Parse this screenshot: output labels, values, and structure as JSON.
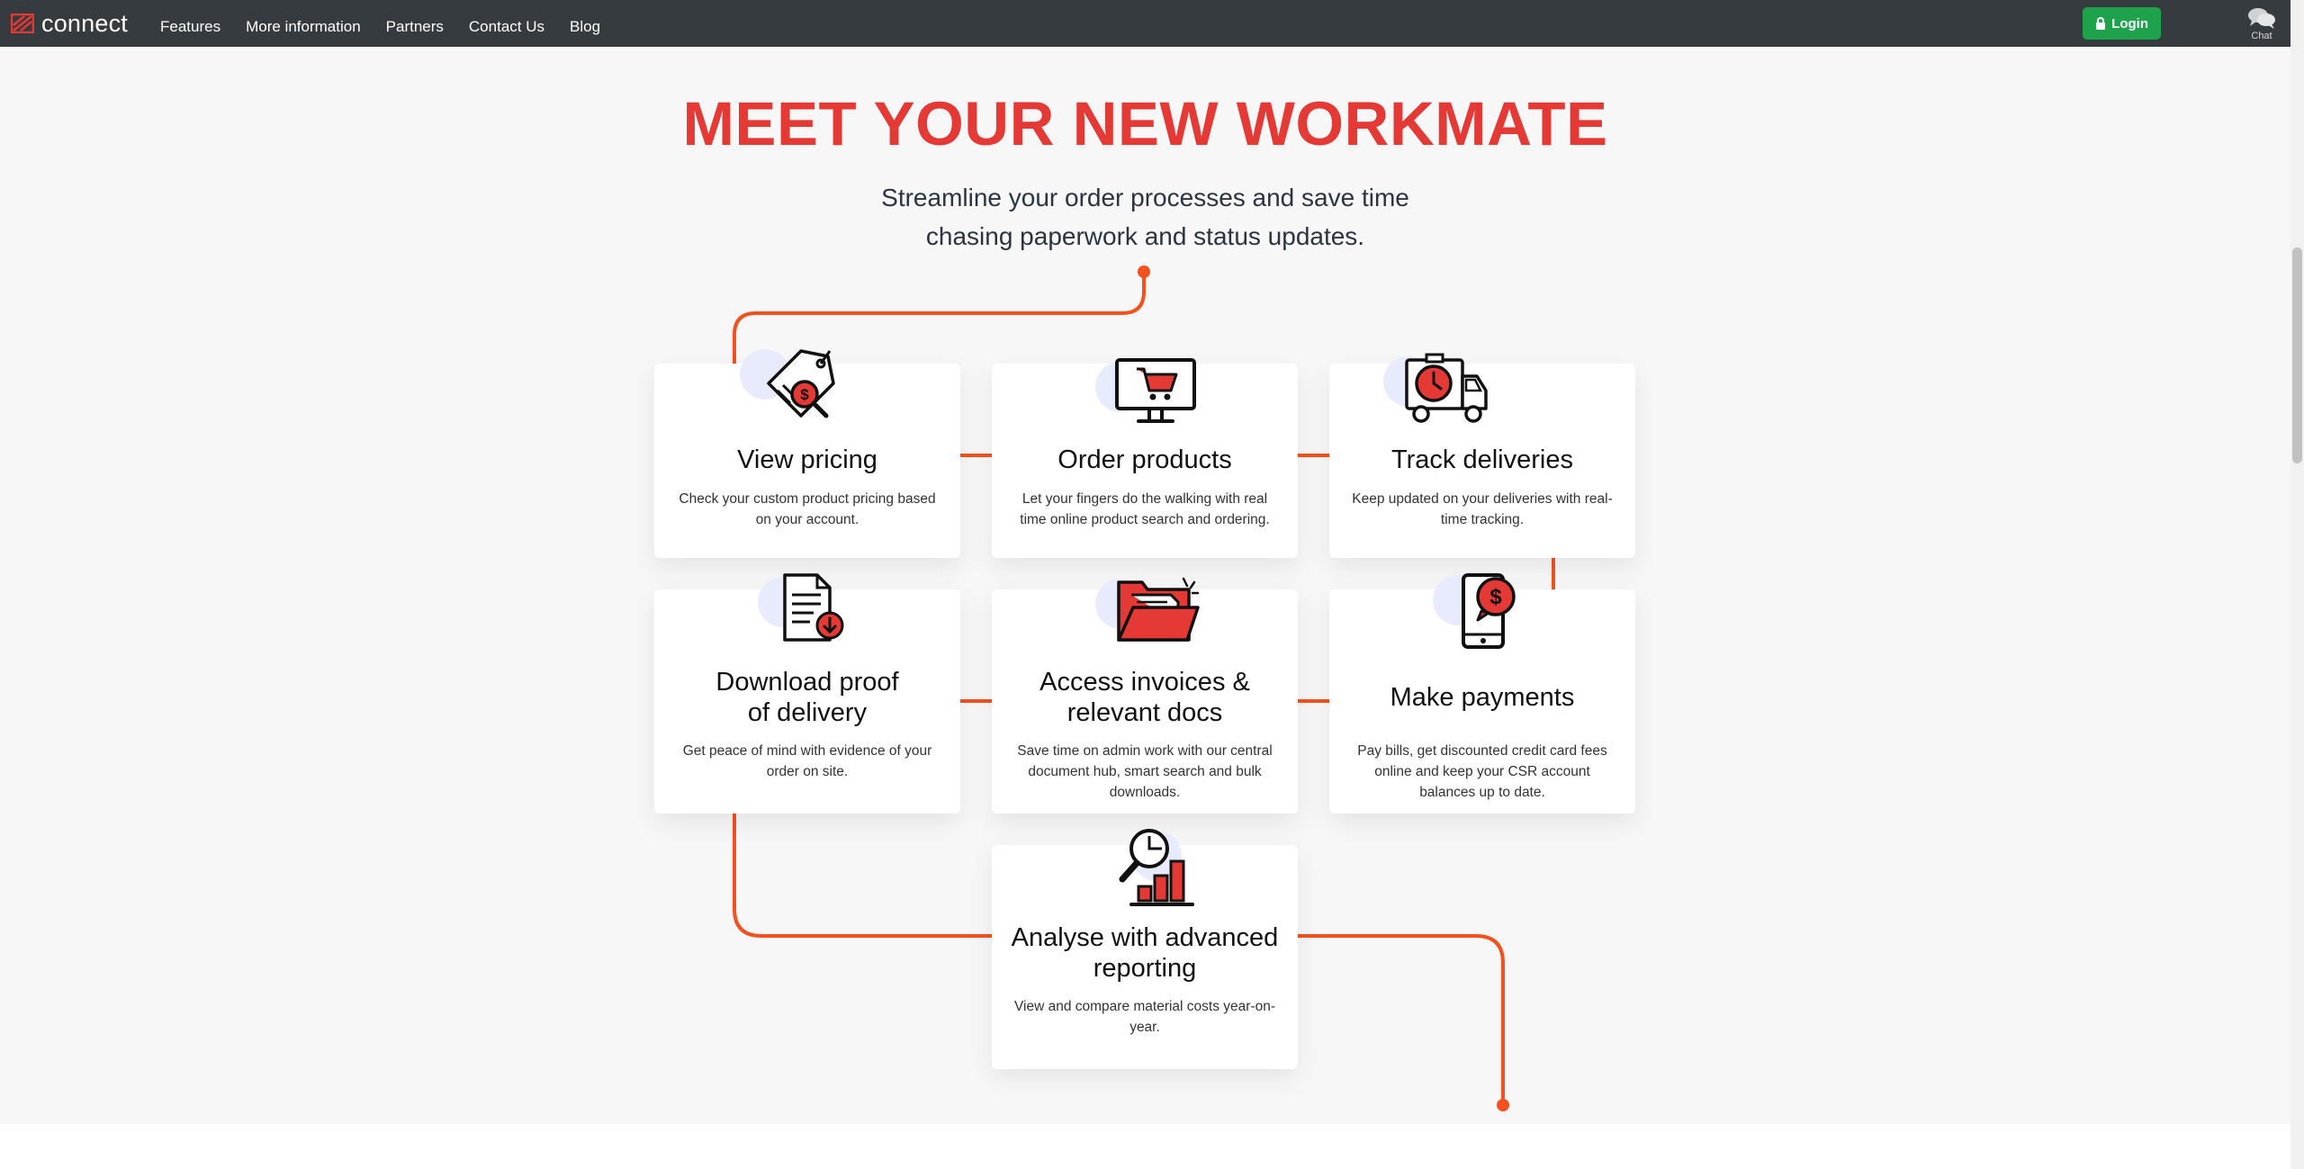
{
  "nav": {
    "brand": "connect",
    "links": [
      "Features",
      "More information",
      "Partners",
      "Contact Us",
      "Blog"
    ],
    "login_label": "Login",
    "chat_label": "Chat"
  },
  "hero": {
    "title": "MEET YOUR NEW WORKMATE",
    "subtitle_line1": "Streamline your order processes and save time",
    "subtitle_line2": "chasing paperwork and status updates."
  },
  "features": [
    {
      "title": "View pricing",
      "desc": "Check your custom product pricing based on your account.",
      "icon": "pricing-tag-icon"
    },
    {
      "title": "Order products",
      "desc": "Let your fingers do the walking with real time online product search and ordering.",
      "icon": "monitor-cart-icon"
    },
    {
      "title": "Track deliveries",
      "desc": "Keep updated on your deliveries with real-time tracking.",
      "icon": "delivery-truck-icon"
    },
    {
      "title": "Download proof of delivery",
      "title_l1": "Download proof",
      "title_l2": "of delivery",
      "desc": "Get peace of mind with evidence of your order on site.",
      "icon": "document-download-icon"
    },
    {
      "title": "Access invoices & relevant docs",
      "title_l1": "Access invoices &",
      "title_l2": "relevant docs",
      "desc": "Save time on admin work with our central document hub, smart search and bulk downloads.",
      "icon": "folder-docs-icon"
    },
    {
      "title": "Make payments",
      "desc": "Pay bills, get discounted credit card fees online and keep your CSR account balances up to date.",
      "icon": "phone-payment-icon"
    },
    {
      "title": "Analyse with advanced reporting",
      "title_l1": "Analyse with advanced",
      "title_l2": "reporting",
      "desc": "View and compare material costs year-on-year.",
      "icon": "report-chart-icon"
    }
  ],
  "colors": {
    "accent": "#e53935",
    "connector": "#f4511e",
    "nav_bg": "#363b3f",
    "login_bg": "#1ea24b",
    "halo": "#e8ebfb"
  }
}
